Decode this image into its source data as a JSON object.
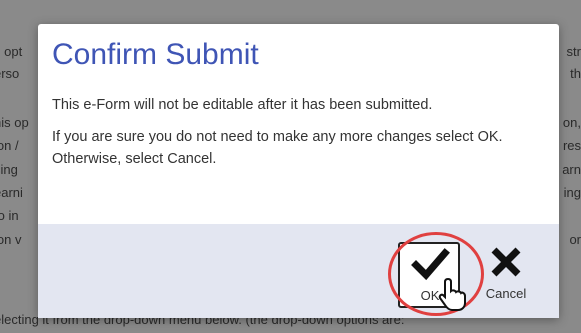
{
  "background": {
    "left_lines": [
      "s opt",
      "erso",
      "",
      "his op",
      "ion /",
      "cing",
      "earni",
      "to in",
      "ion v",
      "",
      "electing it from the drop-down menu below. (the drop-down options are:"
    ],
    "right_lines": [
      "str",
      "th",
      "",
      "on,",
      "res",
      "arn",
      "ing",
      "or"
    ]
  },
  "modal": {
    "title": "Confirm Submit",
    "message_1": "This e-Form will not be editable after it has been submitted.",
    "message_2": "If you are sure you do not need to make any more changes select OK. Otherwise, select Cancel.",
    "ok_label": "OK",
    "cancel_label": "Cancel"
  },
  "colors": {
    "title": "#3f55b5",
    "footer": "#e3e6f1",
    "highlight": "#e04040"
  }
}
